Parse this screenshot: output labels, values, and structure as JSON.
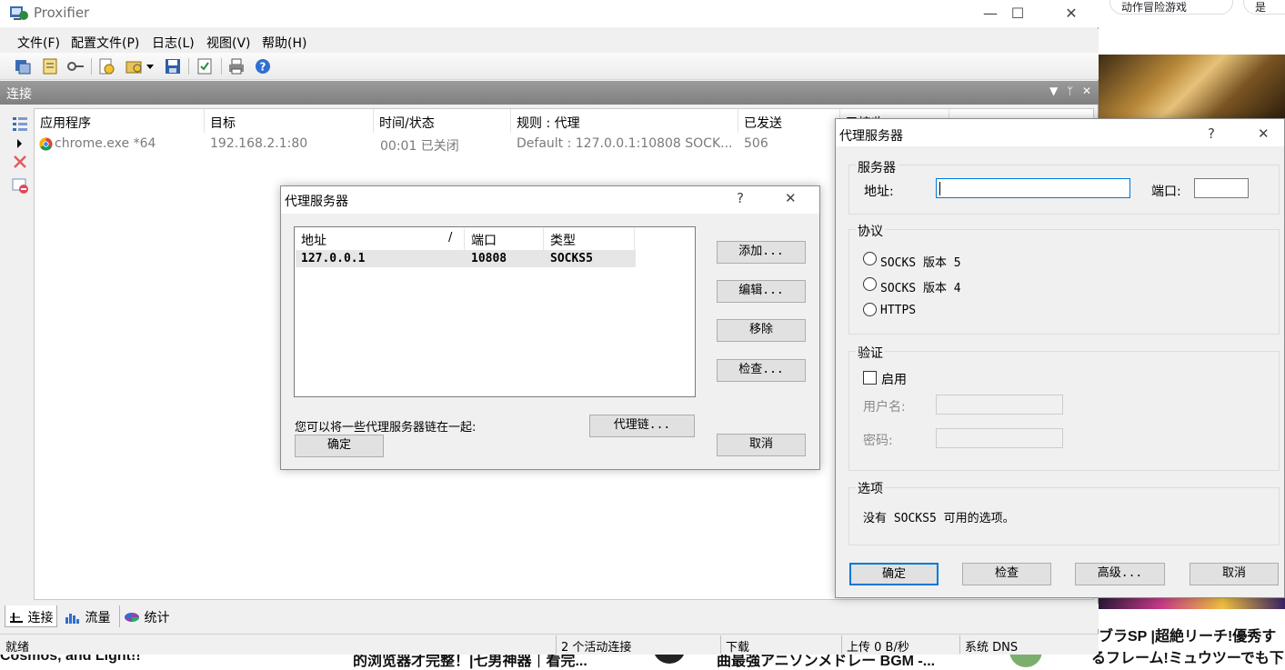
{
  "background": {
    "pill_1": "动作冒险游戏",
    "pill_2": "是",
    "bottom_texts": [
      "Cosmos, and Light!!",
      "的浏览器才完整！|七男神器｜看完...",
      "曲最強アニソンメドレー BGM -...",
      "ブラSP |超絶リーチ!優秀す",
      "るフレーム!ミュウツーでも下ス"
    ]
  },
  "main_window": {
    "title": "Proxifier",
    "controls": {
      "minimize": "—",
      "maximize": "☐",
      "close": "✕"
    },
    "menu": [
      "文件(F)",
      "配置文件(P)",
      "日志(L)",
      "视图(V)",
      "帮助(H)"
    ],
    "toolbar_icons": [
      "profile-icon",
      "rules-icon",
      "key-icon",
      "proxy-add-icon",
      "proxy-settings-icon",
      "dropdown-icon",
      "save-icon",
      "log-icon",
      "print-icon",
      "help-icon"
    ],
    "panel": {
      "title": "连接",
      "controls": {
        "dropdown": "▼",
        "pin": "ᛘ",
        "close": "✕"
      }
    },
    "columns": [
      "应用程序",
      "目标",
      "时间/状态",
      "规则 : 代理",
      "已发送",
      "已接收"
    ],
    "rows": [
      {
        "app": "chrome.exe *64",
        "target": "192.168.2.1:80",
        "time": "00:01 已关闭",
        "rule": "Default : 127.0.0.1:10808 SOCK...",
        "sent": "506"
      }
    ],
    "tabs": [
      "连接",
      "流量",
      "统计"
    ],
    "status": {
      "state": "就绪",
      "active": "2 个活动连接",
      "download": "下载",
      "upload": "上传 0 B/秒",
      "dns": "系统 DNS"
    }
  },
  "proxy_list_dialog": {
    "title": "代理服务器",
    "help": "?",
    "close": "✕",
    "columns": [
      "地址",
      "/",
      "端口",
      "类型"
    ],
    "rows": [
      {
        "address": "127.0.0.1",
        "port": "10808",
        "type": "SOCKS5"
      }
    ],
    "buttons": {
      "add": "添加...",
      "edit": "编辑...",
      "remove": "移除",
      "check": "检查...",
      "chain": "代理链...",
      "ok": "确定",
      "cancel": "取消"
    },
    "chain_hint": "您可以将一些代理服务器链在一起:"
  },
  "proxy_edit_dialog": {
    "title": "代理服务器",
    "help": "?",
    "close": "✕",
    "server_group": "服务器",
    "address_label": "地址:",
    "address_value": "",
    "port_label": "端口:",
    "port_value": "",
    "protocol_group": "协议",
    "protocols": [
      "SOCKS 版本 5",
      "SOCKS 版本 4",
      "HTTPS"
    ],
    "auth_group": "验证",
    "enable_label": "启用",
    "username_label": "用户名:",
    "password_label": "密码:",
    "options_group": "选项",
    "options_text": "没有 SOCKS5 可用的选项。",
    "buttons": {
      "ok": "确定",
      "check": "检查",
      "advanced": "高级...",
      "cancel": "取消"
    }
  }
}
